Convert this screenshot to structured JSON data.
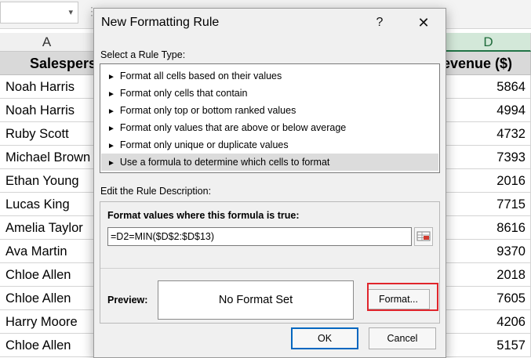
{
  "sheet": {
    "col_a_label": "A",
    "col_d_label": "D",
    "header_salesperson": "Salesperson",
    "header_revenue": "Revenue ($)",
    "rows": [
      {
        "name": "Noah Harris",
        "revenue": "5864"
      },
      {
        "name": "Noah Harris",
        "revenue": "4994"
      },
      {
        "name": "Ruby Scott",
        "revenue": "4732"
      },
      {
        "name": "Michael Brown",
        "revenue": "7393"
      },
      {
        "name": "Ethan Young",
        "revenue": "2016"
      },
      {
        "name": "Lucas King",
        "revenue": "7715"
      },
      {
        "name": "Amelia Taylor",
        "revenue": "8616"
      },
      {
        "name": "Ava Martin",
        "revenue": "9370"
      },
      {
        "name": "Chloe Allen",
        "revenue": "2018"
      },
      {
        "name": "Chloe Allen",
        "revenue": "7605"
      },
      {
        "name": "Harry Moore",
        "revenue": "4206"
      },
      {
        "name": "Chloe Allen",
        "revenue": "5157"
      }
    ]
  },
  "dialog": {
    "title": "New Formatting Rule",
    "help": "?",
    "close": "✕",
    "rule_type_label": "Select a Rule Type:",
    "rule_types": [
      "Format all cells based on their values",
      "Format only cells that contain",
      "Format only top or bottom ranked values",
      "Format only values that are above or below average",
      "Format only unique or duplicate values",
      "Use a formula to determine which cells to format"
    ],
    "selected_rule_index": 5,
    "edit_desc_label": "Edit the Rule Description:",
    "formula_heading": "Format values where this formula is true:",
    "formula_value": "=D2=MIN($D$2:$D$13)",
    "preview_label": "Preview:",
    "preview_text": "No Format Set",
    "format_button": "Format...",
    "ok_button": "OK",
    "cancel_button": "Cancel"
  },
  "colors": {
    "highlight": "#e0242b",
    "ok_border": "#0067c0"
  }
}
